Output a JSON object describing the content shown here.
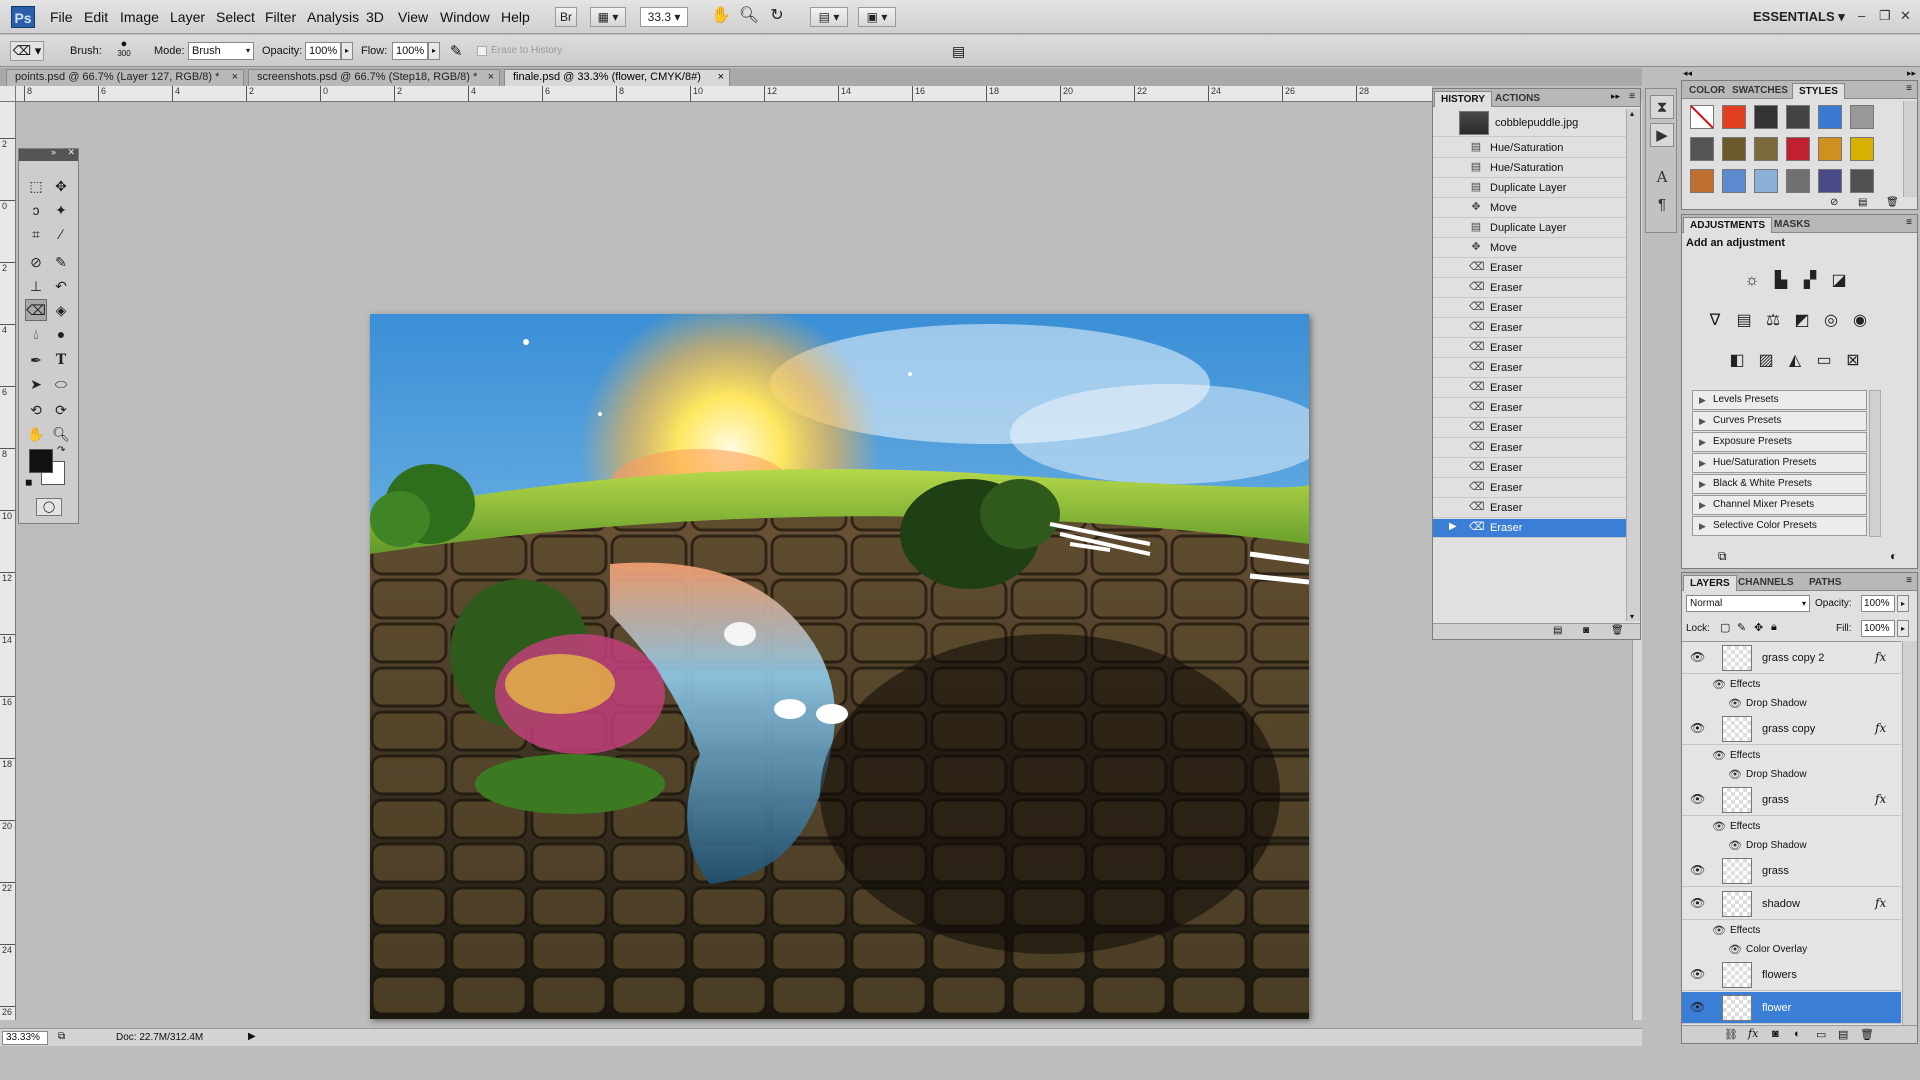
{
  "app": {
    "logo": "Ps"
  },
  "menu": {
    "items": [
      "File",
      "Edit",
      "Image",
      "Layer",
      "Select",
      "Filter",
      "Analysis",
      "3D",
      "View",
      "Window",
      "Help"
    ],
    "bridge_button": "Br",
    "zoom_field": "33.3",
    "workspace": "ESSENTIALS"
  },
  "options": {
    "brush_label": "Brush:",
    "brush_size": "300",
    "mode_label": "Mode:",
    "mode_value": "Brush",
    "opacity_label": "Opacity:",
    "opacity_value": "100%",
    "flow_label": "Flow:",
    "flow_value": "100%",
    "erase_to_history": "Erase to History"
  },
  "tabs": [
    {
      "label": "points.psd @ 66.7% (Layer 127, RGB/8) *"
    },
    {
      "label": "screenshots.psd @ 66.7% (Step18, RGB/8) *"
    },
    {
      "label": "finale.psd @ 33.3% (flower, CMYK/8#)"
    }
  ],
  "rulers": {
    "h": [
      "8",
      "6",
      "4",
      "2",
      "0",
      "2",
      "4",
      "6",
      "8",
      "10",
      "12",
      "14",
      "16",
      "18",
      "20",
      "22",
      "24",
      "26",
      "28"
    ],
    "v": [
      "2",
      "0",
      "2",
      "4",
      "6",
      "8",
      "10",
      "12",
      "14",
      "16",
      "18",
      "20",
      "22",
      "24",
      "26"
    ]
  },
  "status": {
    "zoom": "33.33%",
    "doc": "Doc: 22.7M/312.4M"
  },
  "history": {
    "tabs": [
      "HISTORY",
      "ACTIONS"
    ],
    "snapshot": "cobblepuddle.jpg",
    "items": [
      {
        "label": "Hue/Saturation",
        "icon": "history-step-icon"
      },
      {
        "label": "Hue/Saturation",
        "icon": "history-step-icon"
      },
      {
        "label": "Duplicate Layer",
        "icon": "history-step-icon"
      },
      {
        "label": "Move",
        "icon": "move-icon"
      },
      {
        "label": "Duplicate Layer",
        "icon": "history-step-icon"
      },
      {
        "label": "Move",
        "icon": "move-icon"
      },
      {
        "label": "Eraser",
        "icon": "eraser-icon"
      },
      {
        "label": "Eraser",
        "icon": "eraser-icon"
      },
      {
        "label": "Eraser",
        "icon": "eraser-icon"
      },
      {
        "label": "Eraser",
        "icon": "eraser-icon"
      },
      {
        "label": "Eraser",
        "icon": "eraser-icon"
      },
      {
        "label": "Eraser",
        "icon": "eraser-icon"
      },
      {
        "label": "Eraser",
        "icon": "eraser-icon"
      },
      {
        "label": "Eraser",
        "icon": "eraser-icon"
      },
      {
        "label": "Eraser",
        "icon": "eraser-icon"
      },
      {
        "label": "Eraser",
        "icon": "eraser-icon"
      },
      {
        "label": "Eraser",
        "icon": "eraser-icon"
      },
      {
        "label": "Eraser",
        "icon": "eraser-icon"
      },
      {
        "label": "Eraser",
        "icon": "eraser-icon"
      },
      {
        "label": "Eraser",
        "icon": "eraser-icon"
      }
    ]
  },
  "styles_panel": {
    "tabs": [
      "COLOR",
      "SWATCHES",
      "STYLES"
    ],
    "swatches": [
      "#ffffff",
      "#e04020",
      "#333333",
      "#444444",
      "#3a7ad0",
      "#999999",
      "#555555",
      "#6b5a2a",
      "#7b6a3a",
      "#c02030",
      "#d09020",
      "#d8b000",
      "#c07030",
      "#5a8ad0",
      "#8ab0d8",
      "#707070",
      "#4a4a8a",
      "#505050"
    ]
  },
  "adjustments": {
    "tabs": [
      "ADJUSTMENTS",
      "MASKS"
    ],
    "title": "Add an adjustment",
    "presets": [
      "Levels Presets",
      "Curves Presets",
      "Exposure Presets",
      "Hue/Saturation Presets",
      "Black & White Presets",
      "Channel Mixer Presets",
      "Selective Color Presets"
    ]
  },
  "layers": {
    "tabs": [
      "LAYERS",
      "CHANNELS",
      "PATHS"
    ],
    "blend_mode": "Normal",
    "opacity_label": "Opacity:",
    "opacity": "100%",
    "lock_label": "Lock:",
    "fill_label": "Fill:",
    "fill": "100%",
    "effects_label": "Effects",
    "items": [
      {
        "name": "grass copy 2",
        "fx": true,
        "sub": "Drop Shadow",
        "sel": false
      },
      {
        "name": "grass copy",
        "fx": true,
        "sub": "Drop Shadow",
        "sel": false
      },
      {
        "name": "grass",
        "fx": true,
        "sub": "Drop Shadow",
        "sel": false
      },
      {
        "name": "grass",
        "fx": false,
        "sub": "",
        "sel": false
      },
      {
        "name": "shadow",
        "fx": true,
        "sub": "Color Overlay",
        "sel": false
      },
      {
        "name": "flowers",
        "fx": false,
        "sub": "",
        "sel": false
      },
      {
        "name": "flower",
        "fx": false,
        "sub": "",
        "sel": true
      }
    ],
    "fx_glyph": "fx"
  },
  "colors": {
    "accent": "#3b7ed6",
    "fg": "#111111",
    "bg": "#ffffff"
  }
}
